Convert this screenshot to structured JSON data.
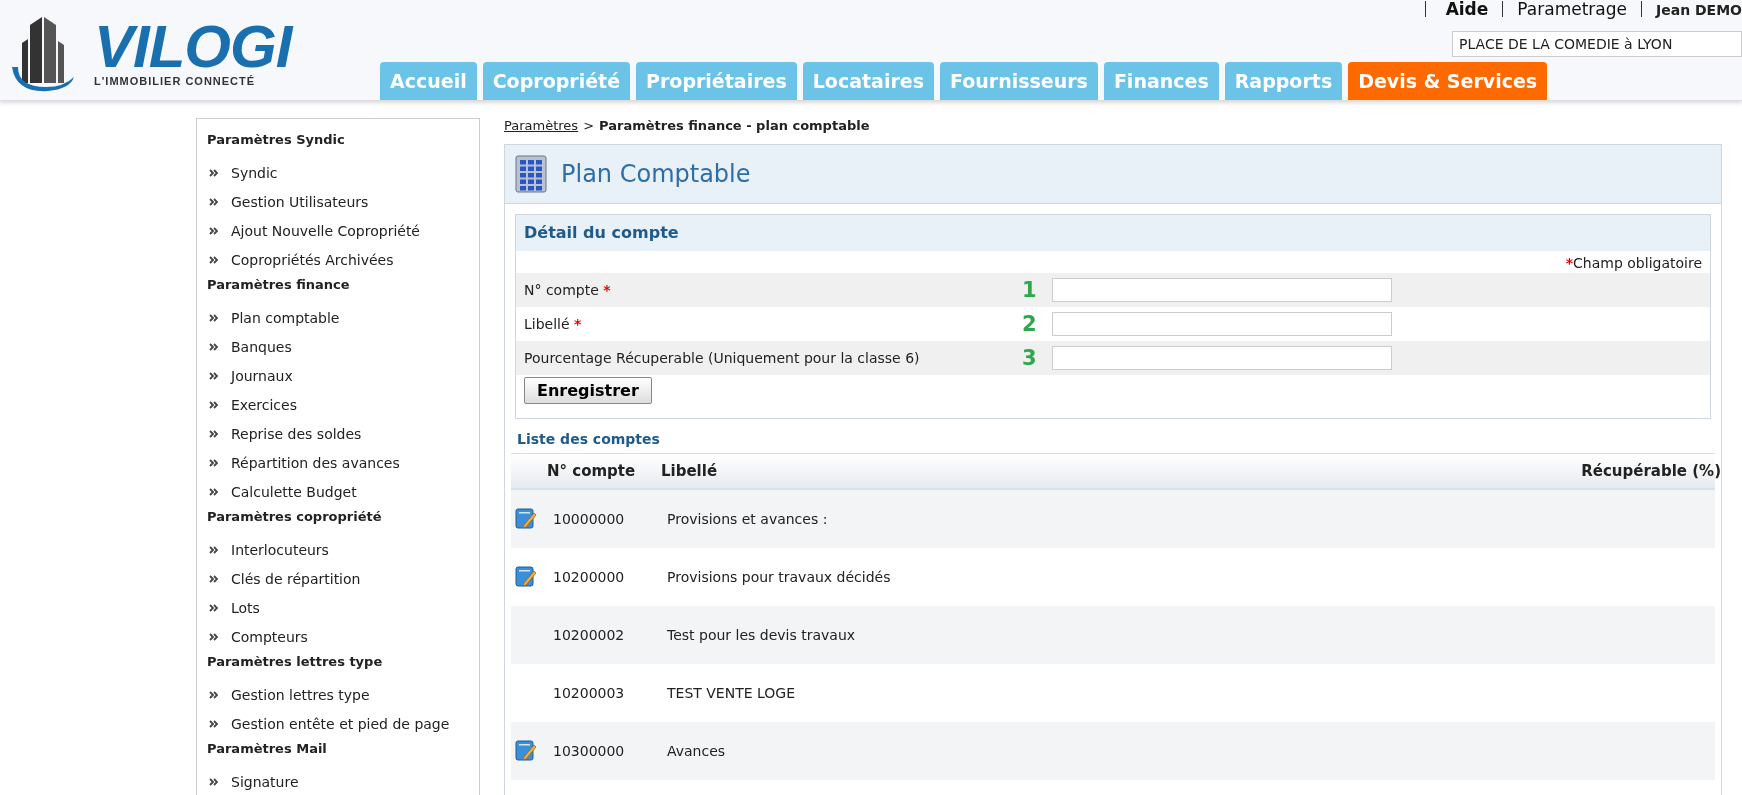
{
  "logo": {
    "name": "VILOGI",
    "tagline": "L'IMMOBILIER CONNECTÉ"
  },
  "top_links": [
    "Aide",
    "Parametrage"
  ],
  "user": "Jean DEMO",
  "property_field": {
    "value": "PLACE DE LA COMEDIE à LYON"
  },
  "tabs": [
    {
      "label": "Accueil",
      "selected": false
    },
    {
      "label": "Copropriété",
      "selected": false
    },
    {
      "label": "Propriétaires",
      "selected": false
    },
    {
      "label": "Locataires",
      "selected": false
    },
    {
      "label": "Fournisseurs",
      "selected": false
    },
    {
      "label": "Finances",
      "selected": false
    },
    {
      "label": "Rapports",
      "selected": false
    },
    {
      "label": "Devis & Services",
      "selected": true
    }
  ],
  "sidebar": {
    "sections": [
      {
        "title": "Paramètres Syndic",
        "items": [
          "Syndic",
          "Gestion Utilisateurs",
          "Ajout Nouvelle Copropriété",
          "Copropriétés Archivées"
        ]
      },
      {
        "title": "Paramètres finance",
        "items": [
          "Plan comptable",
          "Banques",
          "Journaux",
          "Exercices",
          "Reprise des soldes",
          "Répartition des avances",
          "Calculette Budget"
        ]
      },
      {
        "title": "Paramètres copropriété",
        "items": [
          "Interlocuteurs",
          "Clés de répartition",
          "Lots",
          "Compteurs"
        ]
      },
      {
        "title": "Paramètres lettres type",
        "items": [
          "Gestion lettres type",
          "Gestion entête et pied de page"
        ]
      },
      {
        "title": "Paramètres Mail",
        "items": [
          "Signature"
        ]
      }
    ]
  },
  "breadcrumb": {
    "link": "Paramètres",
    "separator": ">",
    "current": "Paramètres finance - plan comptable"
  },
  "page_title": "Plan Comptable",
  "detail": {
    "title": "Détail du compte",
    "required_mark": "*",
    "required_note": "Champ obligatoire",
    "fields": [
      {
        "label": "N° compte",
        "required": true,
        "marker": "1"
      },
      {
        "label": "Libellé",
        "required": true,
        "marker": "2"
      },
      {
        "label": "Pourcentage Récuperable (Uniquement pour la classe 6)",
        "required": false,
        "marker": "3"
      }
    ],
    "save_button": "Enregistrer"
  },
  "list": {
    "title": "Liste des comptes",
    "columns": [
      "N° compte",
      "Libellé",
      "Récupérable (%)"
    ],
    "rows": [
      {
        "number": "10000000",
        "label": "Provisions et avances :",
        "editable": true
      },
      {
        "number": "10200000",
        "label": "Provisions pour travaux décidés",
        "editable": true
      },
      {
        "number": "10200002",
        "label": "Test pour les devis travaux",
        "editable": false
      },
      {
        "number": "10200003",
        "label": "TEST VENTE LOGE",
        "editable": false
      },
      {
        "number": "10300000",
        "label": "Avances",
        "editable": true
      }
    ]
  }
}
